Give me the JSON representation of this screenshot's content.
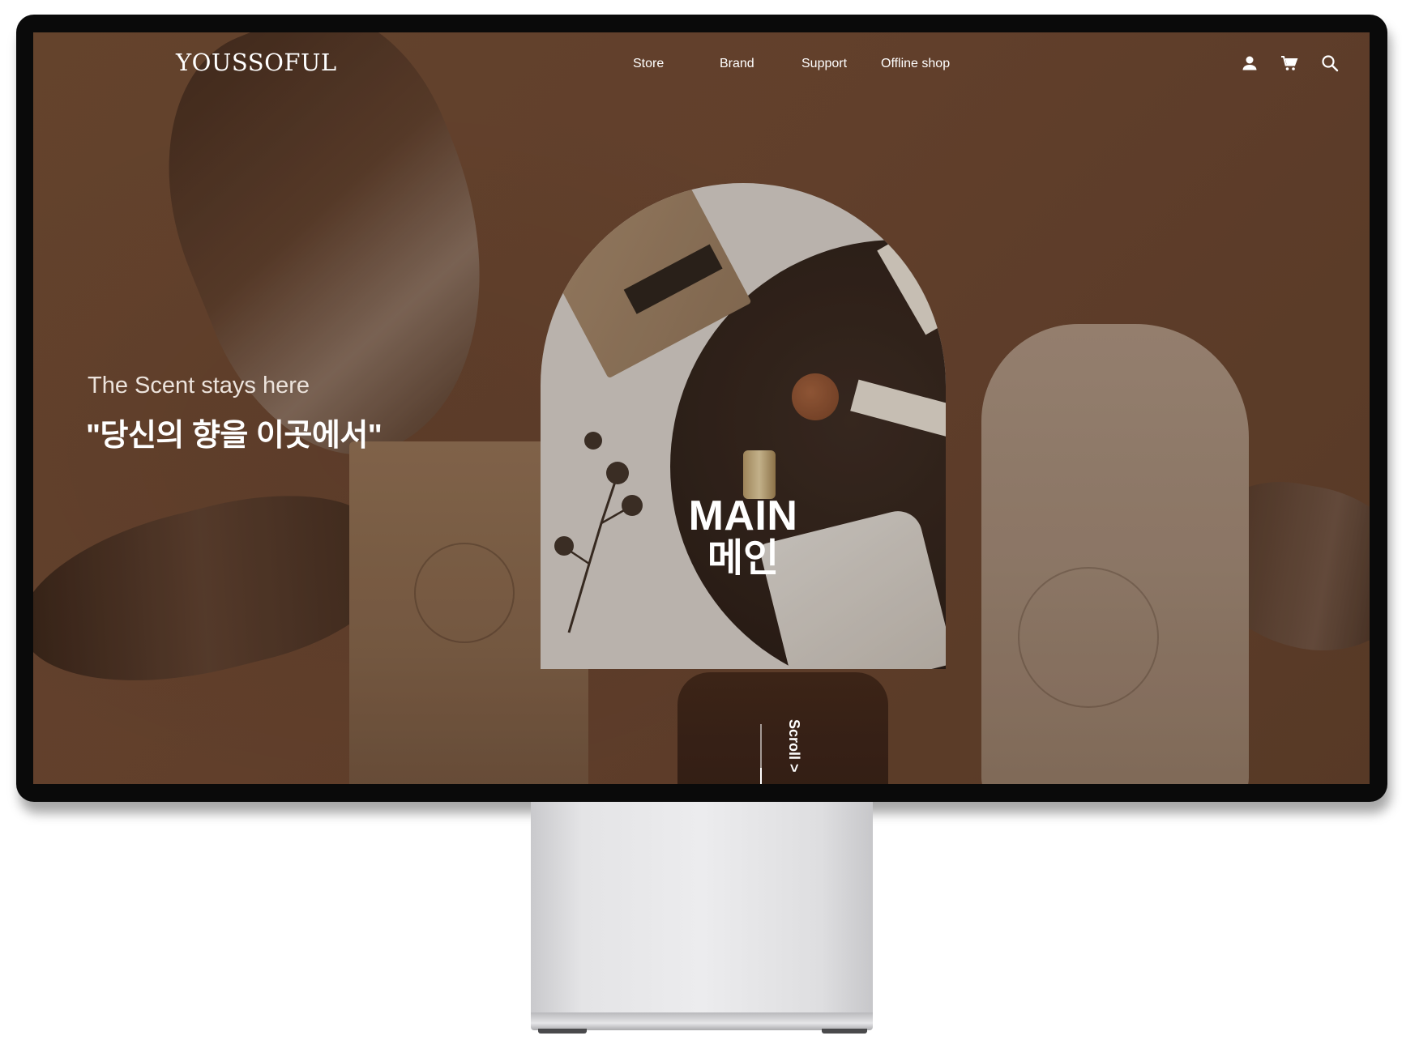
{
  "site": {
    "logo": "YOUSSOFUL"
  },
  "nav": {
    "items": [
      {
        "label": "Store"
      },
      {
        "label": "Brand"
      },
      {
        "label": "Support"
      },
      {
        "label": "Offline shop"
      }
    ],
    "icons": [
      "user-icon",
      "cart-icon",
      "search-icon"
    ]
  },
  "hero": {
    "tagline": "The Scent stays here",
    "headline": "\"당신의 향을 이곳에서\"",
    "main_title": "MAIN",
    "main_subtitle": "메인",
    "scroll_label": "Scroll >"
  },
  "colors": {
    "background": "#6a4630",
    "text": "#ffffff",
    "monitor_frame": "#0a0a0a",
    "stand": "#e4e4e6"
  }
}
